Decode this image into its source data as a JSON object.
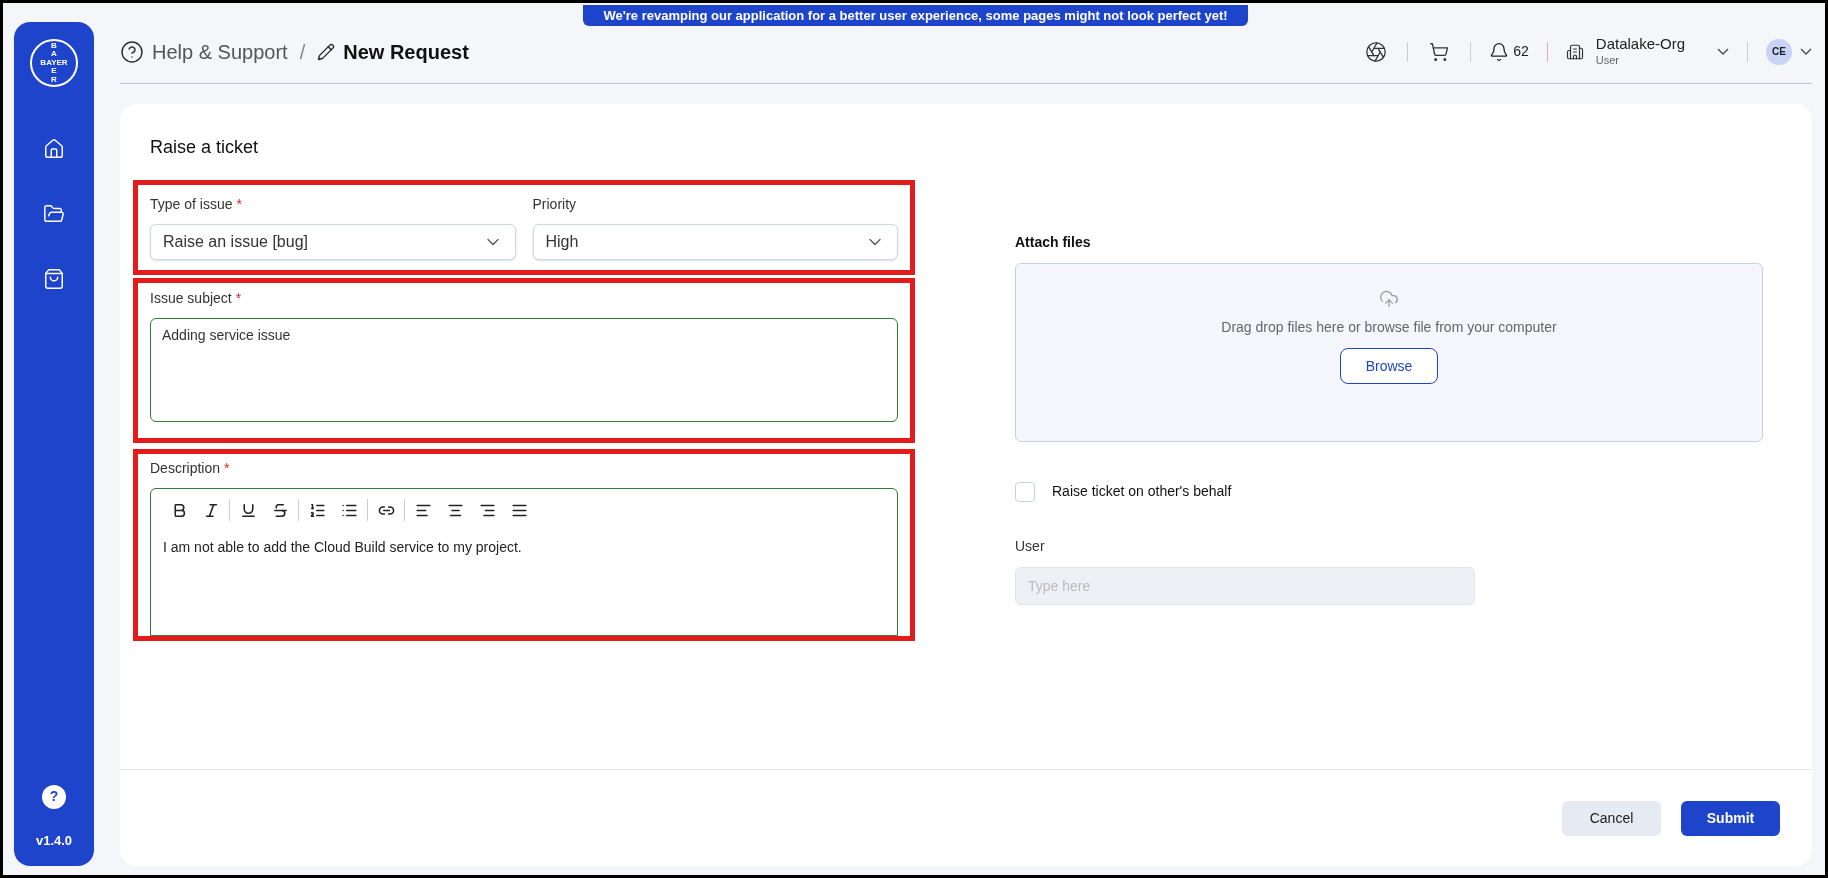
{
  "banner": "We're revamping our application for a better user experience, some pages might not look perfect yet!",
  "sidebar": {
    "logo": {
      "horizontal": "BAYER",
      "vertical_top": "BA",
      "vertical_bottom": "ER"
    },
    "items": [
      {
        "kind": "home",
        "selected": false
      },
      {
        "kind": "folder",
        "selected": false
      },
      {
        "kind": "bag",
        "selected": false
      }
    ],
    "help": "?",
    "version": "v1.4.0"
  },
  "breadcrumb": {
    "parent": "Help & Support",
    "separator": "/",
    "current": "New Request"
  },
  "header": {
    "notifications": "62",
    "org": "Datalake-Org",
    "role": "User",
    "avatar": "CE"
  },
  "form": {
    "title": "Raise a ticket",
    "type_of_issue": {
      "label": "Type of issue",
      "required_mark": "*",
      "value": "Raise an issue [bug]"
    },
    "priority": {
      "label": "Priority",
      "value": "High"
    },
    "issue_subject": {
      "label": "Issue subject",
      "required_mark": "*",
      "value": "Adding service issue"
    },
    "description": {
      "label": "Description",
      "required_mark": "*",
      "toolbar": [
        {
          "items": [
            {
              "kind": "bold"
            },
            {
              "kind": "italic"
            }
          ]
        },
        {
          "items": [
            {
              "kind": "underline"
            },
            {
              "kind": "strikethrough"
            }
          ]
        },
        {
          "items": [
            {
              "kind": "ordered-list"
            },
            {
              "kind": "bullet-list"
            }
          ]
        },
        {
          "items": [
            {
              "kind": "link"
            }
          ]
        },
        {
          "items": [
            {
              "kind": "align-left"
            },
            {
              "kind": "align-center"
            },
            {
              "kind": "align-right"
            },
            {
              "kind": "align-justify"
            }
          ]
        }
      ],
      "value": "I am not able to add the Cloud Build service to my project."
    },
    "attach": {
      "label": "Attach files",
      "hint": "Drag drop files here or browse file from your computer",
      "button": "Browse"
    },
    "behalf": {
      "label": "Raise ticket on other's behalf",
      "checked": false
    },
    "user": {
      "label": "User",
      "placeholder": "Type here"
    }
  },
  "buttons": {
    "cancel": "Cancel",
    "submit": "Submit"
  }
}
